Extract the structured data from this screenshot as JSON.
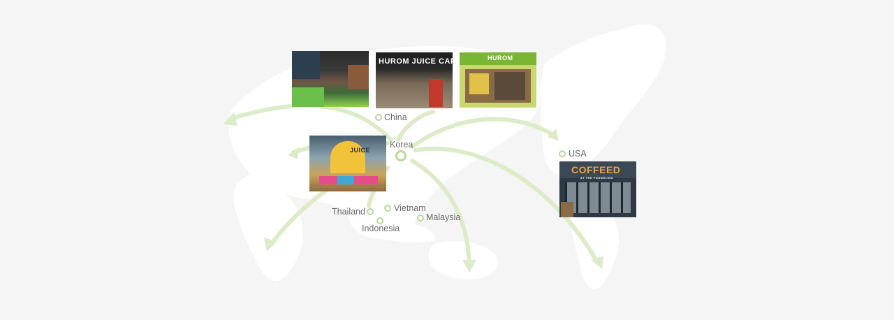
{
  "locations": {
    "china": "China",
    "korea": "Korea",
    "usa": "USA",
    "thailand": "Thailand",
    "vietnam": "Vietnam",
    "indonesia": "Indonesia",
    "malaysia": "Malaysia"
  },
  "store_signs": {
    "store_2": "HUROM JUICE CAFE",
    "store_3": "HUROM",
    "store_4": "JUICE",
    "store_5": "COFFEED",
    "store_5_sub": "AT THE FOUNDLING"
  },
  "colors": {
    "background": "#f5f5f5",
    "continents": "#ffffff",
    "arrows": "#dcecc8",
    "marker": "#b9d99a",
    "label_text": "#6b6b6b"
  }
}
